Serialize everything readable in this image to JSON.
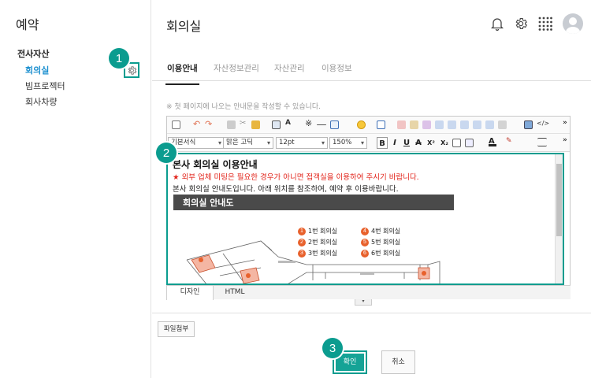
{
  "sidebar": {
    "title": "예약",
    "group": "전사자산",
    "items": [
      {
        "label": "회의실",
        "active": true
      },
      {
        "label": "빔프로젝터",
        "active": false
      },
      {
        "label": "회사차량",
        "active": false
      }
    ]
  },
  "main": {
    "title": "회의실"
  },
  "tabs": [
    "이용안내",
    "자산정보관리",
    "자산관리",
    "이용정보"
  ],
  "editor": {
    "note": "※ 첫 페이지에 나오는 안내문을 작성할 수 있습니다.",
    "paragraph_style": "기본서식",
    "font": "맑은 고딕",
    "font_size": "12pt",
    "zoom": "150%",
    "format_buttons": [
      "B",
      "I",
      "U",
      "A",
      "X²",
      "X₂"
    ],
    "content": {
      "title": "본사 회의실 이용안내",
      "warning_star": "★",
      "warning": "외부 업체 미팅은 필요한 경우가 아니면 접객실을 이용하여 주시기 바랍니다.",
      "info": "본사 회의실 안내도입니다. 아래 위치를 참조하여, 예약 후 이용바랍니다.",
      "banner": "회의실 안내도",
      "legend": [
        {
          "num": "1",
          "label": "1번 회의실"
        },
        {
          "num": "2",
          "label": "2번 회의실"
        },
        {
          "num": "3",
          "label": "3번 회의실"
        },
        {
          "num": "4",
          "label": "4번 회의실"
        },
        {
          "num": "5",
          "label": "5번 회의실"
        },
        {
          "num": "6",
          "label": "6번 회의실"
        }
      ]
    },
    "modes": [
      "디자인",
      "HTML"
    ]
  },
  "buttons": {
    "attach": "파일첨부",
    "confirm": "확인",
    "cancel": "취소"
  },
  "badges": [
    "1",
    "2",
    "3"
  ],
  "colors": {
    "accent": "#0b9c8f",
    "active_link": "#1b8fcf",
    "warning": "#e2231a",
    "legend_dot": "#e8612c"
  },
  "icons": [
    "bell-icon",
    "gear-icon",
    "apps-grid-icon",
    "avatar"
  ]
}
